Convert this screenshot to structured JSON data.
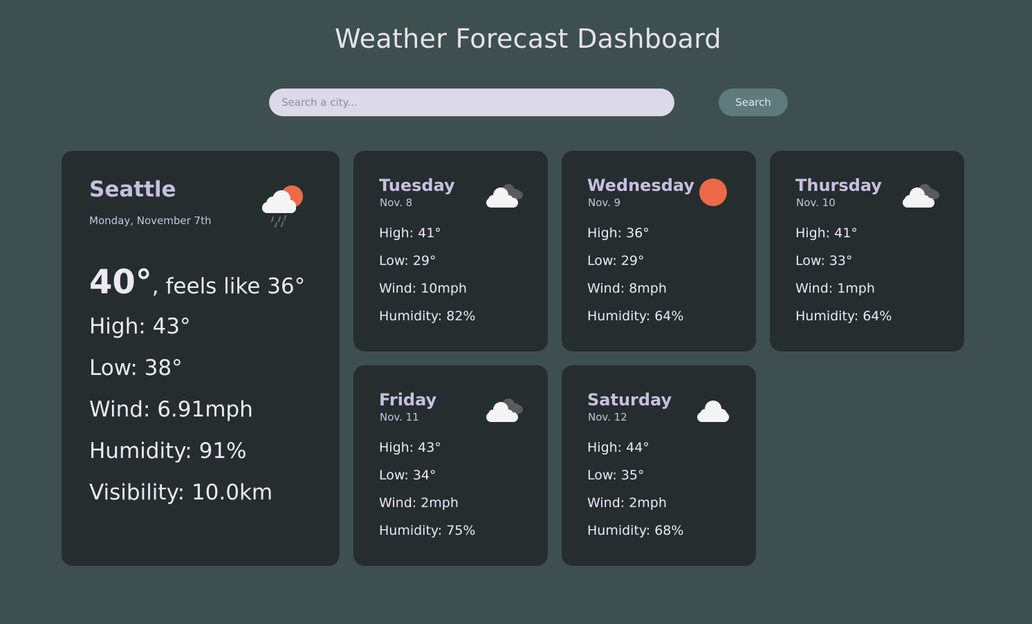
{
  "header": {
    "title": "Weather Forecast Dashboard"
  },
  "search": {
    "placeholder": "Search a city...",
    "button_label": "Search"
  },
  "colors": {
    "background": "#3e4f4f",
    "card": "#252d2f",
    "accent": "#c7bfe0",
    "sun": "#ec6a48"
  },
  "current": {
    "city": "Seattle",
    "date": "Monday, November 7th",
    "icon": "sun-cloud-rain-icon",
    "temp": "40°",
    "feels_like": ", feels like 36°",
    "high": "High: 43°",
    "low": "Low: 38°",
    "wind": "Wind: 6.91mph",
    "humidity": "Humidity: 91%",
    "visibility": "Visibility: 10.0km"
  },
  "forecast": [
    {
      "day": "Tuesday",
      "date": "Nov. 8",
      "icon": "cloudy-icon",
      "high": "High: 41°",
      "low": "Low: 29°",
      "wind": "Wind: 10mph",
      "humidity": "Humidity: 82%"
    },
    {
      "day": "Wednesday",
      "date": "Nov. 9",
      "icon": "sun-icon",
      "high": "High: 36°",
      "low": "Low: 29°",
      "wind": "Wind: 8mph",
      "humidity": "Humidity: 64%"
    },
    {
      "day": "Thursday",
      "date": "Nov. 10",
      "icon": "cloudy-icon",
      "high": "High: 41°",
      "low": "Low: 33°",
      "wind": "Wind: 1mph",
      "humidity": "Humidity: 64%"
    },
    {
      "day": "Friday",
      "date": "Nov. 11",
      "icon": "cloudy-icon",
      "high": "High: 43°",
      "low": "Low: 34°",
      "wind": "Wind: 2mph",
      "humidity": "Humidity: 75%"
    },
    {
      "day": "Saturday",
      "date": "Nov. 12",
      "icon": "cloud-icon",
      "high": "High: 44°",
      "low": "Low: 35°",
      "wind": "Wind: 2mph",
      "humidity": "Humidity: 68%"
    }
  ]
}
